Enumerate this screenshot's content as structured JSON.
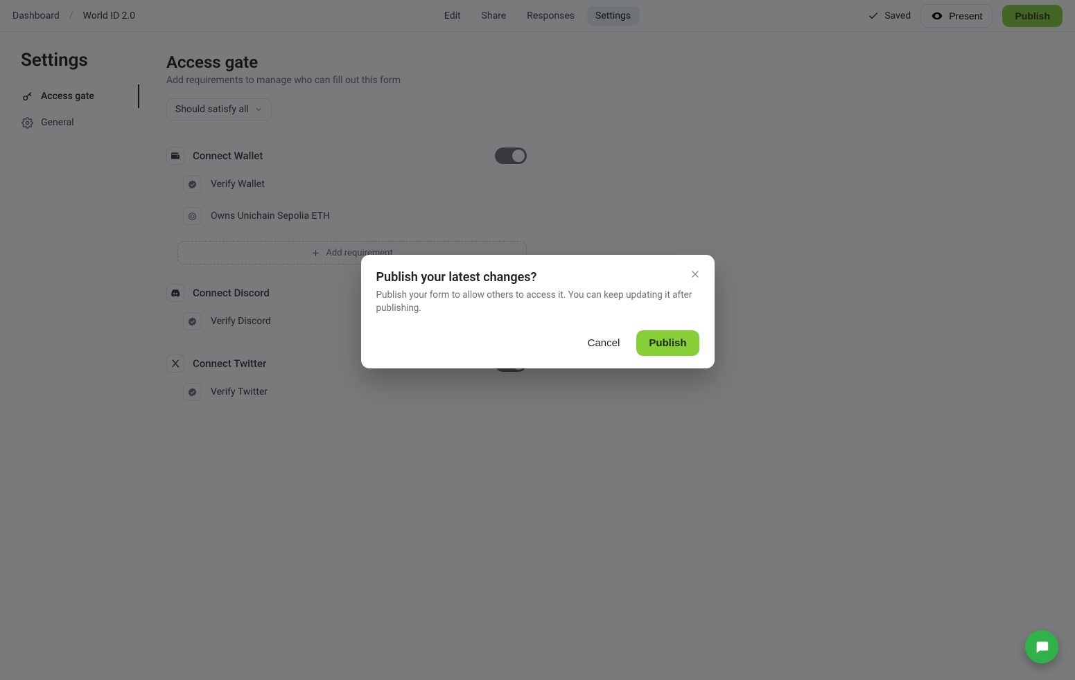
{
  "header": {
    "breadcrumb_root": "Dashboard",
    "breadcrumb_sep": "/",
    "breadcrumb_current": "World ID 2.0",
    "tabs": {
      "edit": "Edit",
      "share": "Share",
      "responses": "Responses",
      "settings": "Settings"
    },
    "saved_label": "Saved",
    "present_label": "Present",
    "publish_label": "Publish"
  },
  "sidebar": {
    "title": "Settings",
    "items": [
      {
        "id": "access-gate",
        "label": "Access gate",
        "active": true
      },
      {
        "id": "general",
        "label": "General",
        "active": false
      }
    ]
  },
  "main": {
    "title": "Access gate",
    "subtitle": "Add requirements to manage who can fill out this form",
    "satisfy_selector": "Should satisfy all",
    "gates": [
      {
        "id": "wallet",
        "title": "Connect Wallet",
        "reqs": [
          {
            "label": "Verify Wallet"
          },
          {
            "label": "Owns Unichain Sepolia ETH"
          }
        ],
        "add_label": "Add requirement"
      },
      {
        "id": "discord",
        "title": "Connect Discord",
        "reqs": [
          {
            "label": "Verify Discord"
          }
        ]
      },
      {
        "id": "twitter",
        "title": "Connect Twitter",
        "reqs": [
          {
            "label": "Verify Twitter"
          }
        ]
      }
    ]
  },
  "modal": {
    "title": "Publish your latest changes?",
    "body": "Publish your form to allow others to access it. You can keep updating it after publishing.",
    "cancel": "Cancel",
    "confirm": "Publish"
  },
  "colors": {
    "accent": "#8fd13f"
  }
}
